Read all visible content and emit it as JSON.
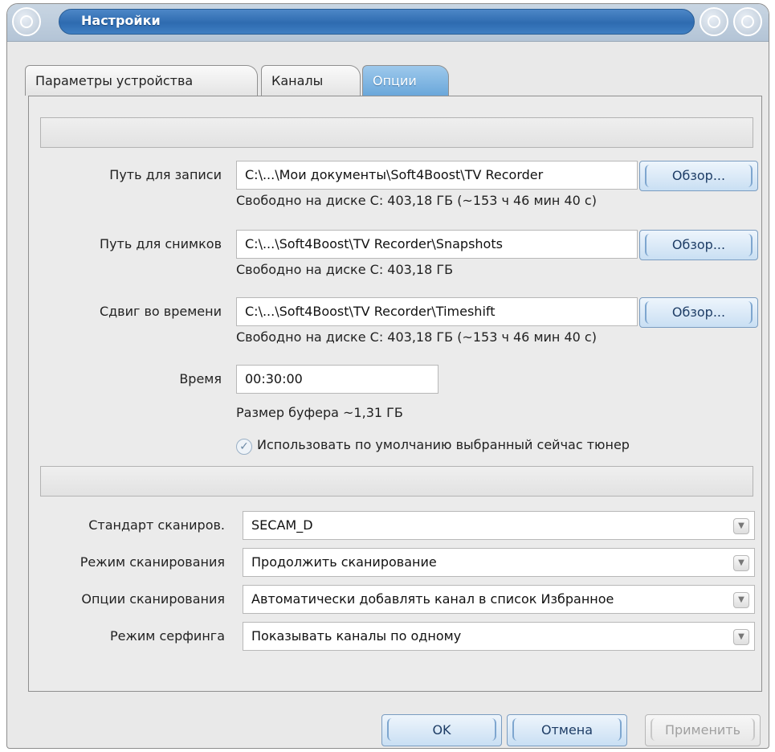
{
  "window": {
    "title": "Настройки"
  },
  "tabs": [
    {
      "label": "Параметры устройства"
    },
    {
      "label": "Каналы"
    },
    {
      "label": "Опции"
    }
  ],
  "record": {
    "label": "Путь для записи",
    "value": "C:\\...\\Мои документы\\Soft4Boost\\TV Recorder",
    "info": "Свободно на диске C: 403,18 ГБ (~153 ч 46 мин 40 с)",
    "browse_label": "Обзор..."
  },
  "snapshots": {
    "label": "Путь для снимков",
    "value": "C:\\...\\Soft4Boost\\TV Recorder\\Snapshots",
    "info": "Свободно на диске C: 403,18 ГБ",
    "browse_label": "Обзор..."
  },
  "timeshift": {
    "label": "Сдвиг во времени",
    "value": "C:\\...\\Soft4Boost\\TV Recorder\\Timeshift",
    "info": "Свободно на диске C: 403,18 ГБ (~153 ч 46 мин 40 с)",
    "browse_label": "Обзор..."
  },
  "time": {
    "label": "Время",
    "value": "00:30:00",
    "buffer_info": "Размер буфера ~1,31 ГБ"
  },
  "default_tuner": {
    "label": "Использовать по умолчанию выбранный сейчас тюнер",
    "checked": true
  },
  "scan": {
    "standard": {
      "label": "Стандарт сканиров.",
      "value": "SECAM_D"
    },
    "mode": {
      "label": "Режим сканирования",
      "value": "Продолжить сканирование"
    },
    "options": {
      "label": "Опции сканирования",
      "value": "Автоматически добавлять канал в список Избранное"
    },
    "surf": {
      "label": "Режим серфинга",
      "value": "Показывать каналы по одному"
    }
  },
  "buttons": {
    "ok": "OK",
    "cancel": "Отмена",
    "apply": "Применить"
  },
  "icons": {
    "checkbox": "checkmark-icon",
    "dropdown": "chevron-down-icon"
  }
}
